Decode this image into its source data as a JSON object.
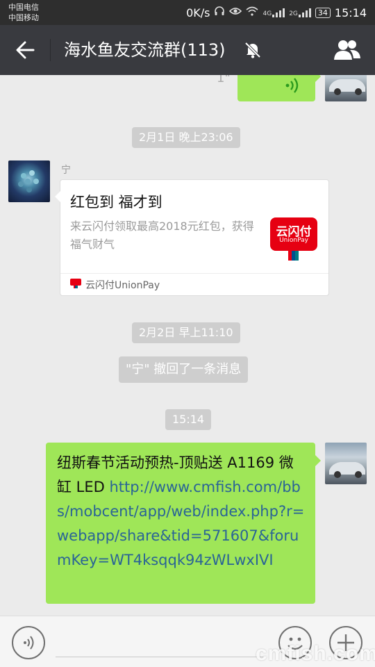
{
  "status_bar": {
    "carrier_1": "中国电信",
    "carrier_2": "中国移动",
    "speed": "0K/s",
    "network_1": "4G",
    "network_2": "2G",
    "battery": "34",
    "time": "15:14"
  },
  "header": {
    "title": "海水鱼友交流群(113)",
    "back_icon": "arrow-left-icon",
    "mute_icon": "bell-off-icon",
    "members_icon": "group-members-icon"
  },
  "messages": {
    "voice_duration": "1\"",
    "time_1": "2月1日 晚上23:06",
    "sender": "宁",
    "card": {
      "title": "红包到 福才到",
      "description": "来云闪付领取最高2018元红包，获得福气财气",
      "logo_text": "云闪付",
      "logo_subtext": "UnionPay",
      "footer": "云闪付UnionPay"
    },
    "time_2": "2月2日 早上11:10",
    "recall_notice": "\"宁\" 撤回了一条消息",
    "time_3": "15:14",
    "text_message": {
      "prefix": "纽斯春节活动预热-顶贴送 A1169 微缸 LED ",
      "link": "http://www.cmfish.com/bbs/mobcent/app/web/index.php?r=webapp/share&tid=571607&forumKey=WT4ksqqk94zWLwxIVI"
    }
  },
  "input_bar": {
    "voice_icon": "voice-input-icon",
    "emoji_icon": "emoji-icon",
    "plus_icon": "plus-icon"
  },
  "watermark": "cmfish.com",
  "colors": {
    "header_bg": "#393a3f",
    "status_bg": "#2e2e2e",
    "chat_bg": "#ebebeb",
    "bubble_green": "#9fe658",
    "link": "#2a6496",
    "unionpay_red": "#e60012"
  }
}
